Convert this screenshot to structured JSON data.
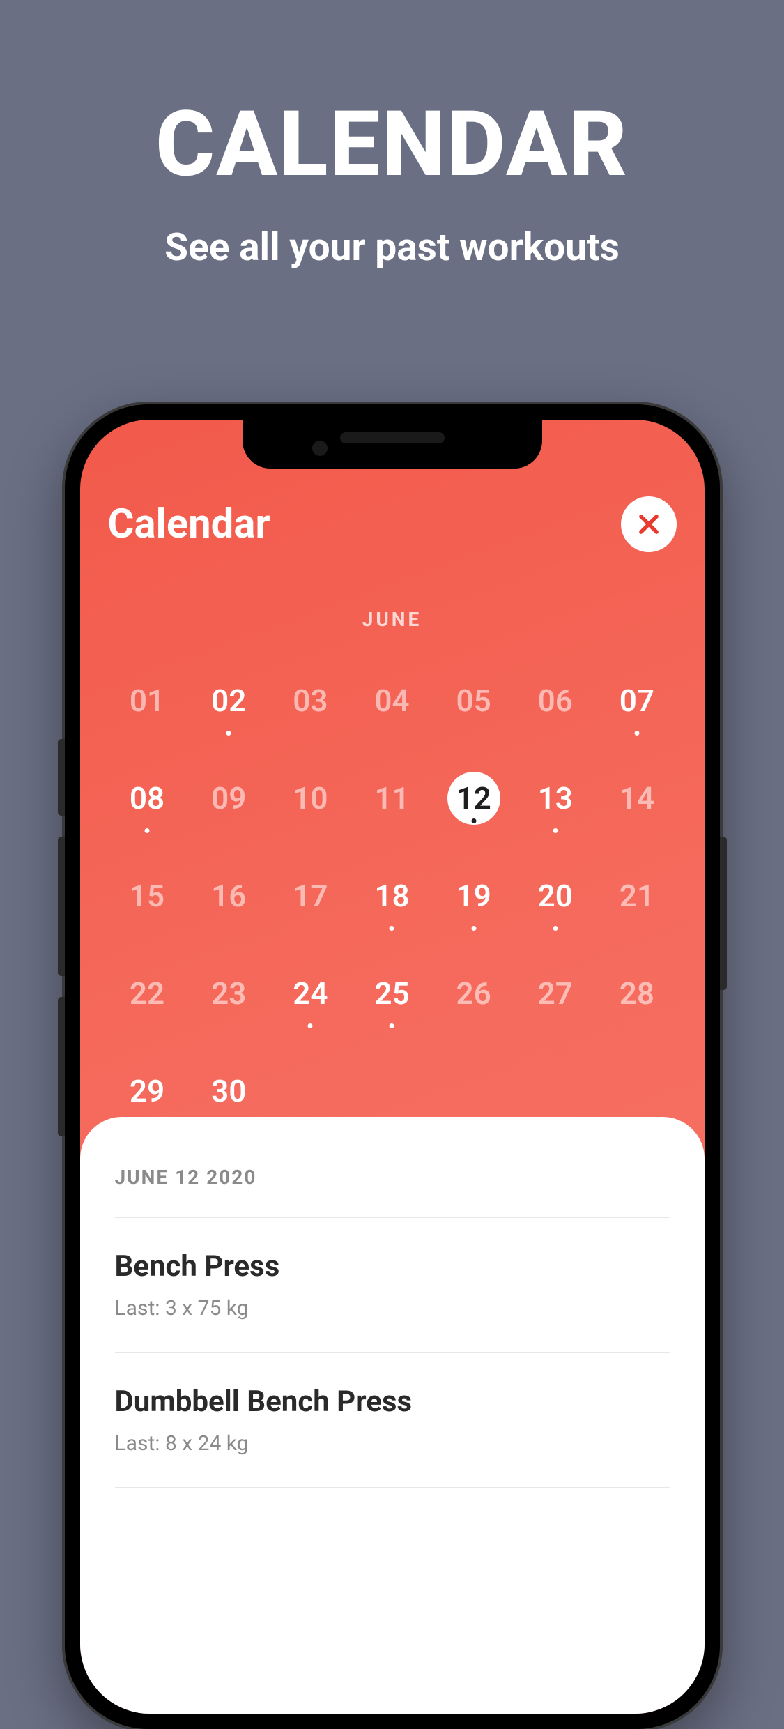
{
  "promo": {
    "title": "CALENDAR",
    "subtitle": "See all your past workouts"
  },
  "app": {
    "title": "Calendar",
    "month": "JUNE",
    "days": [
      {
        "n": "01",
        "active": false,
        "dot": false,
        "selected": false
      },
      {
        "n": "02",
        "active": true,
        "dot": true,
        "selected": false
      },
      {
        "n": "03",
        "active": false,
        "dot": false,
        "selected": false
      },
      {
        "n": "04",
        "active": false,
        "dot": false,
        "selected": false
      },
      {
        "n": "05",
        "active": false,
        "dot": false,
        "selected": false
      },
      {
        "n": "06",
        "active": false,
        "dot": false,
        "selected": false
      },
      {
        "n": "07",
        "active": true,
        "dot": true,
        "selected": false
      },
      {
        "n": "08",
        "active": true,
        "dot": true,
        "selected": false
      },
      {
        "n": "09",
        "active": false,
        "dot": false,
        "selected": false
      },
      {
        "n": "10",
        "active": false,
        "dot": false,
        "selected": false
      },
      {
        "n": "11",
        "active": false,
        "dot": false,
        "selected": false
      },
      {
        "n": "12",
        "active": true,
        "dot": true,
        "selected": true
      },
      {
        "n": "13",
        "active": true,
        "dot": true,
        "selected": false
      },
      {
        "n": "14",
        "active": false,
        "dot": false,
        "selected": false
      },
      {
        "n": "15",
        "active": false,
        "dot": false,
        "selected": false
      },
      {
        "n": "16",
        "active": false,
        "dot": false,
        "selected": false
      },
      {
        "n": "17",
        "active": false,
        "dot": false,
        "selected": false
      },
      {
        "n": "18",
        "active": true,
        "dot": true,
        "selected": false
      },
      {
        "n": "19",
        "active": true,
        "dot": true,
        "selected": false
      },
      {
        "n": "20",
        "active": true,
        "dot": true,
        "selected": false
      },
      {
        "n": "21",
        "active": false,
        "dot": false,
        "selected": false
      },
      {
        "n": "22",
        "active": false,
        "dot": false,
        "selected": false
      },
      {
        "n": "23",
        "active": false,
        "dot": false,
        "selected": false
      },
      {
        "n": "24",
        "active": true,
        "dot": true,
        "selected": false
      },
      {
        "n": "25",
        "active": true,
        "dot": true,
        "selected": false
      },
      {
        "n": "26",
        "active": false,
        "dot": false,
        "selected": false
      },
      {
        "n": "27",
        "active": false,
        "dot": false,
        "selected": false
      },
      {
        "n": "28",
        "active": false,
        "dot": false,
        "selected": false
      },
      {
        "n": "29",
        "active": true,
        "dot": true,
        "selected": false
      },
      {
        "n": "30",
        "active": true,
        "dot": true,
        "selected": false
      }
    ],
    "selected_date_label": "JUNE 12 2020",
    "exercises": [
      {
        "name": "Bench Press",
        "sub": "Last: 3 x 75 kg"
      },
      {
        "name": "Dumbbell Bench Press",
        "sub": "Last: 8 x 24 kg"
      }
    ]
  }
}
